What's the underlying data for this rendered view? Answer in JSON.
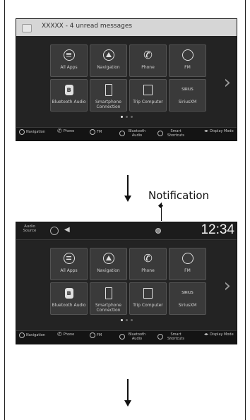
{
  "screen1": {
    "banner_text": "XXXXX - 4 unread messages"
  },
  "screen2": {
    "status_audio_label": "Audio Source",
    "clock": "12:34"
  },
  "callout": {
    "label": "Notification"
  },
  "tiles": [
    {
      "label": "All Apps",
      "icon": "all-apps-icon"
    },
    {
      "label": "Navigation",
      "icon": "navigation-icon"
    },
    {
      "label": "Phone",
      "icon": "phone-icon"
    },
    {
      "label": "FM",
      "icon": "fm-icon"
    },
    {
      "label": "Bluetooth Audio",
      "icon": "bluetooth-icon"
    },
    {
      "label": "Smartphone Connection",
      "icon": "smartphone-icon"
    },
    {
      "label": "Trip Computer",
      "icon": "trip-computer-icon"
    },
    {
      "label": "SiriusXM",
      "icon": "siriusxm-icon"
    }
  ],
  "sirius_logo_text": "SIRIUS",
  "bottom_bar": [
    {
      "label": "Navigation",
      "icon": "navigation-icon"
    },
    {
      "label": "Phone",
      "icon": "phone-icon"
    },
    {
      "label": "FM",
      "icon": "fm-icon"
    },
    {
      "label": "Bluetooth Audio",
      "icon": "bluetooth-icon"
    },
    {
      "label": "Smart Shortcuts",
      "icon": "shortcuts-icon"
    },
    {
      "label": "Display Mode",
      "icon": "display-mode-icon"
    }
  ],
  "page_indicator": {
    "pages": 3,
    "current": 1
  },
  "colors": {
    "screen_bg": "#232323",
    "tile_bg": "#3a3a3a",
    "banner_bg": "#d6d6d6",
    "text_light": "#cfcfcf"
  }
}
